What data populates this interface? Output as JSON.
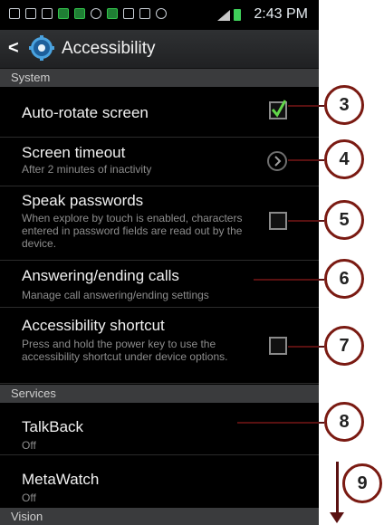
{
  "status_bar": {
    "time": "2:43 PM"
  },
  "title_bar": {
    "back": "<",
    "title": "Accessibility",
    "icon": "gear-icon"
  },
  "sections": {
    "system": "System",
    "services": "Services",
    "vision": "Vision"
  },
  "rows": [
    {
      "title": "Auto-rotate screen",
      "subtitle": "",
      "control": "checkbox",
      "checked": true
    },
    {
      "title": "Screen timeout",
      "subtitle": "After 2 minutes of inactivity",
      "control": "chevron"
    },
    {
      "title": "Speak passwords",
      "subtitle": "When explore by touch is enabled, characters entered in password fields are read out by the device.",
      "control": "checkbox",
      "checked": false
    },
    {
      "title": "Answering/ending calls",
      "subtitle": "Manage call answering/ending settings",
      "control": "none"
    },
    {
      "title": "Accessibility shortcut",
      "subtitle": "Press and hold the power key to use the accessibility shortcut under device options.",
      "control": "checkbox",
      "checked": false
    },
    {
      "title": "TalkBack",
      "subtitle": "Off",
      "control": "none"
    },
    {
      "title": "MetaWatch",
      "subtitle": "Off",
      "control": "none"
    }
  ],
  "callouts": [
    "3",
    "4",
    "5",
    "6",
    "7",
    "8",
    "9"
  ],
  "colors": {
    "background": "#000000",
    "section_bg": "#3a3b3d",
    "check_green": "#62d64a",
    "callout_border": "#7a1a12"
  }
}
